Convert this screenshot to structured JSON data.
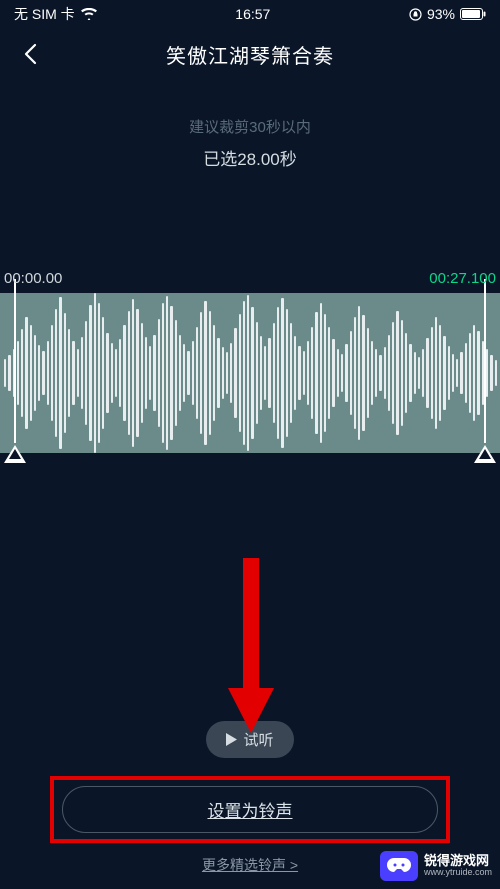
{
  "status": {
    "carrier": "无 SIM 卡",
    "time": "16:57",
    "battery": "93%"
  },
  "header": {
    "title": "笑傲江湖琴箫合奏"
  },
  "hints": {
    "suggestion": "建议裁剪30秒以内",
    "selected": "已选28.00秒"
  },
  "times": {
    "start": "00:00.00",
    "end": "00:27.100"
  },
  "buttons": {
    "preview": "试听",
    "setRingtone": "设置为铃声",
    "more": "更多精选铃声 >"
  },
  "watermark": {
    "brand": "锐得游戏网",
    "url": "www.ytruide.com"
  }
}
